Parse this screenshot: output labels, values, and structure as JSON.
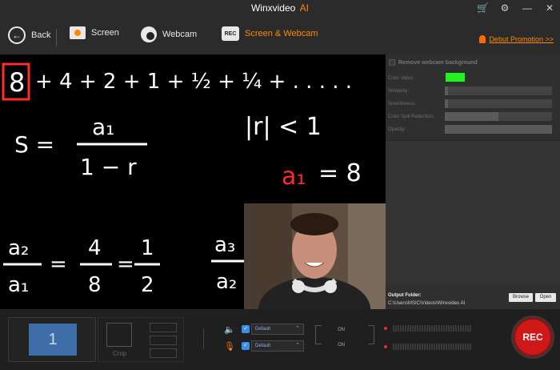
{
  "app": {
    "title": "Winxvideo",
    "title_suffix": "AI"
  },
  "window_icons": [
    "cart-icon",
    "settings-icon",
    "minimize-icon",
    "close-icon"
  ],
  "nav": {
    "back_label": "Back",
    "tabs": [
      {
        "label": "Screen",
        "icon": "screen-icon"
      },
      {
        "label": "Webcam",
        "icon": "webcam-icon"
      },
      {
        "label": "Screen & Webcam",
        "icon": "rec-icon",
        "active": true
      }
    ],
    "promo_label": "Debut Promotion >>"
  },
  "preview": {
    "math_text": {
      "line1_boxed": "8",
      "line1_rest": "+ 4 + 2 + 1 + ½ + ¼ + . . . . .",
      "formula_s": "S =",
      "formula_num": "a₁",
      "formula_den": "1 − r",
      "condition": "|r| < 1",
      "a1_label": "a₁",
      "a1_value": "= 8",
      "ratio_left_num": "a₂",
      "ratio_left_den": "a₁",
      "ratio_mid_num": "4",
      "ratio_mid_den": "8",
      "ratio_right_num": "1",
      "ratio_right_den": "2",
      "ratio_cut_num": "a₃",
      "ratio_cut_den": "a₂"
    }
  },
  "webcam_settings": {
    "remove_bg_label": "Remove webcam background",
    "props": [
      "Color Value:",
      "Similarity:",
      "Smoothness:",
      "Color Spill Reduction:",
      "Opacity:"
    ],
    "color_value": "#22f222",
    "similarity_level": 0.03,
    "smoothness_level": 0.03,
    "spill_level": 0.5,
    "opacity_level": 1.0
  },
  "output": {
    "label": "Output Folder:",
    "path": "C:\\Users\\MSIC\\Videos\\Winxvideo AI",
    "browse_label": "Browse",
    "open_label": "Open"
  },
  "bottom": {
    "screen_number": "1",
    "crop_label": "Crop",
    "speaker_device": "Default",
    "mic_device": "Default",
    "speaker_state": "ON",
    "mic_state": "ON",
    "rec_label": "REC"
  }
}
